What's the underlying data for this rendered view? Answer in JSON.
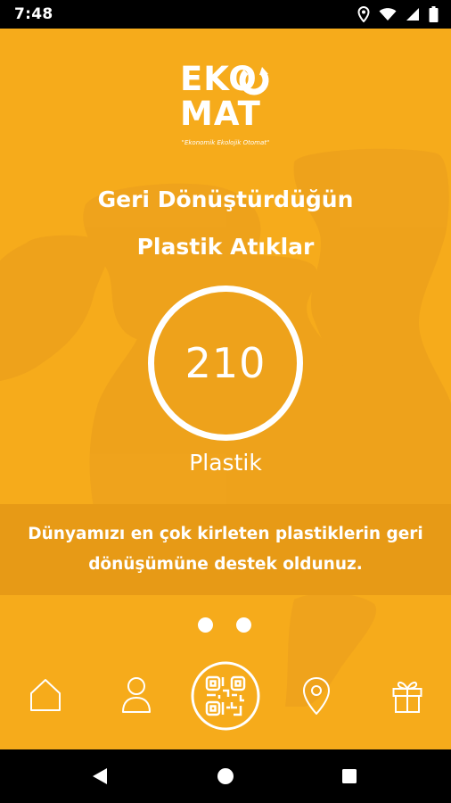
{
  "status_bar": {
    "time": "7:48"
  },
  "logo": {
    "line1": "EKO",
    "line2": "MAT",
    "tagline": "\"Ekonomik Ekolojik Otomat\""
  },
  "title": {
    "line1": "Geri Dönüştürdüğün",
    "line2": "Plastik Atıklar"
  },
  "counter": {
    "value": "210",
    "unit": "Plastik"
  },
  "message": {
    "line1": "Dünyamızı en çok kirleten plastiklerin geri",
    "line2": "dönüşümüne destek oldunuz."
  },
  "pager": {
    "total": 2
  },
  "bottom_nav": {
    "items": [
      {
        "icon": "home-icon"
      },
      {
        "icon": "profile-icon"
      },
      {
        "icon": "qr-code-icon"
      },
      {
        "icon": "location-pin-icon"
      },
      {
        "icon": "gift-icon"
      }
    ]
  },
  "colors": {
    "background": "#F6AB1B",
    "band": "#E79A16",
    "accent": "#FFFFFF"
  }
}
